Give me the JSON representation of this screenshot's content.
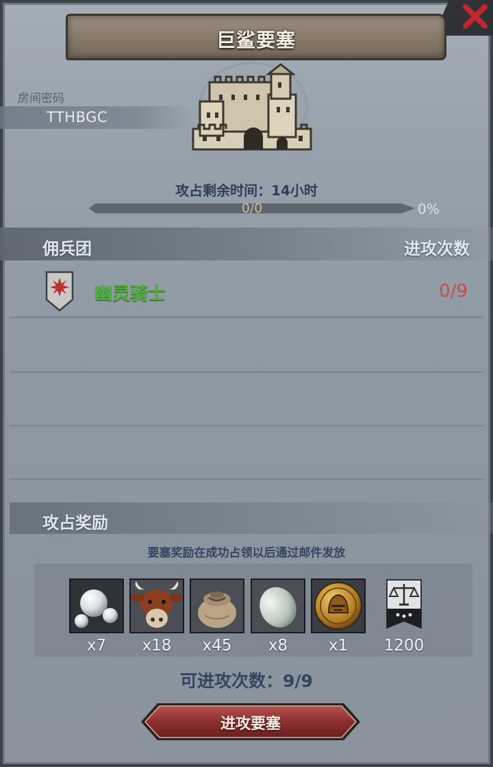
{
  "title": "巨鲨要塞",
  "room": {
    "label": "房间密码",
    "code": "TTHBGC"
  },
  "time_remaining": "攻占剩余时间：14小时",
  "progress": {
    "text": "0/0",
    "percent_label": "0%",
    "fraction": 0
  },
  "mercenaries": {
    "column_team": "佣兵团",
    "column_attacks": "进攻次数",
    "rows": [
      {
        "name": "幽灵骑士",
        "attacks": "0/9",
        "name_color": "#4cb23a",
        "attacks_color": "#c84b45"
      }
    ]
  },
  "rewards": {
    "title": "攻占奖励",
    "note": "要塞奖励在成功占领以后通过邮件发放",
    "items": [
      {
        "icon": "pearls-icon",
        "qty": "x7"
      },
      {
        "icon": "cow-icon",
        "qty": "x18"
      },
      {
        "icon": "sack-icon",
        "qty": "x45"
      },
      {
        "icon": "egg-icon",
        "qty": "x8"
      },
      {
        "icon": "helmet-coin-icon",
        "qty": "x1"
      },
      {
        "icon": "justice-banner-icon",
        "qty": "1200"
      }
    ]
  },
  "attempts": "可进攻次数：9/9",
  "attack_button": "进攻要塞",
  "colors": {
    "accent_red": "#8e2f2f",
    "title_banner": "#8a7d6e"
  }
}
